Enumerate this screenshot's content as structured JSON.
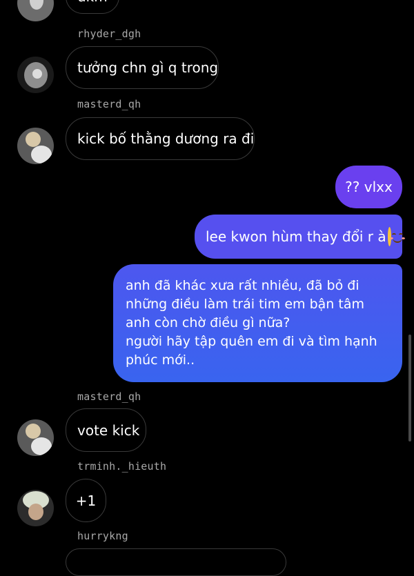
{
  "messages": {
    "top_partial": "ukm",
    "m1": {
      "sender": "rhyder_dgh",
      "text": "tưởng chn gì q trong"
    },
    "m2": {
      "sender": "masterd_qh",
      "text": "kick bố thằng dương ra đi"
    },
    "m3": {
      "text": "?? vlxx"
    },
    "m4": {
      "text": "lee kwon hùm thay đổi r à",
      "emoji": "smiling-face-emoji"
    },
    "m5": {
      "lines": [
        "anh đã khác xưa rất nhiều, đã bỏ đi",
        "những điều làm trái tim em bận tâm",
        "anh còn chờ điều gì nữa?",
        "người hãy tập quên em đi và tìm hạnh",
        "phúc mới.."
      ]
    },
    "m6": {
      "sender": "masterd_qh",
      "text": "vote kick"
    },
    "m7": {
      "sender": "trminh._hieuth",
      "text": "+1"
    },
    "m8": {
      "sender": "hurrykng"
    }
  },
  "colors": {
    "outgoing_top": "#6e3ff0",
    "outgoing_bottom": "#3d5ef0",
    "incoming_border": "#3a3a3a",
    "background": "#000000"
  }
}
